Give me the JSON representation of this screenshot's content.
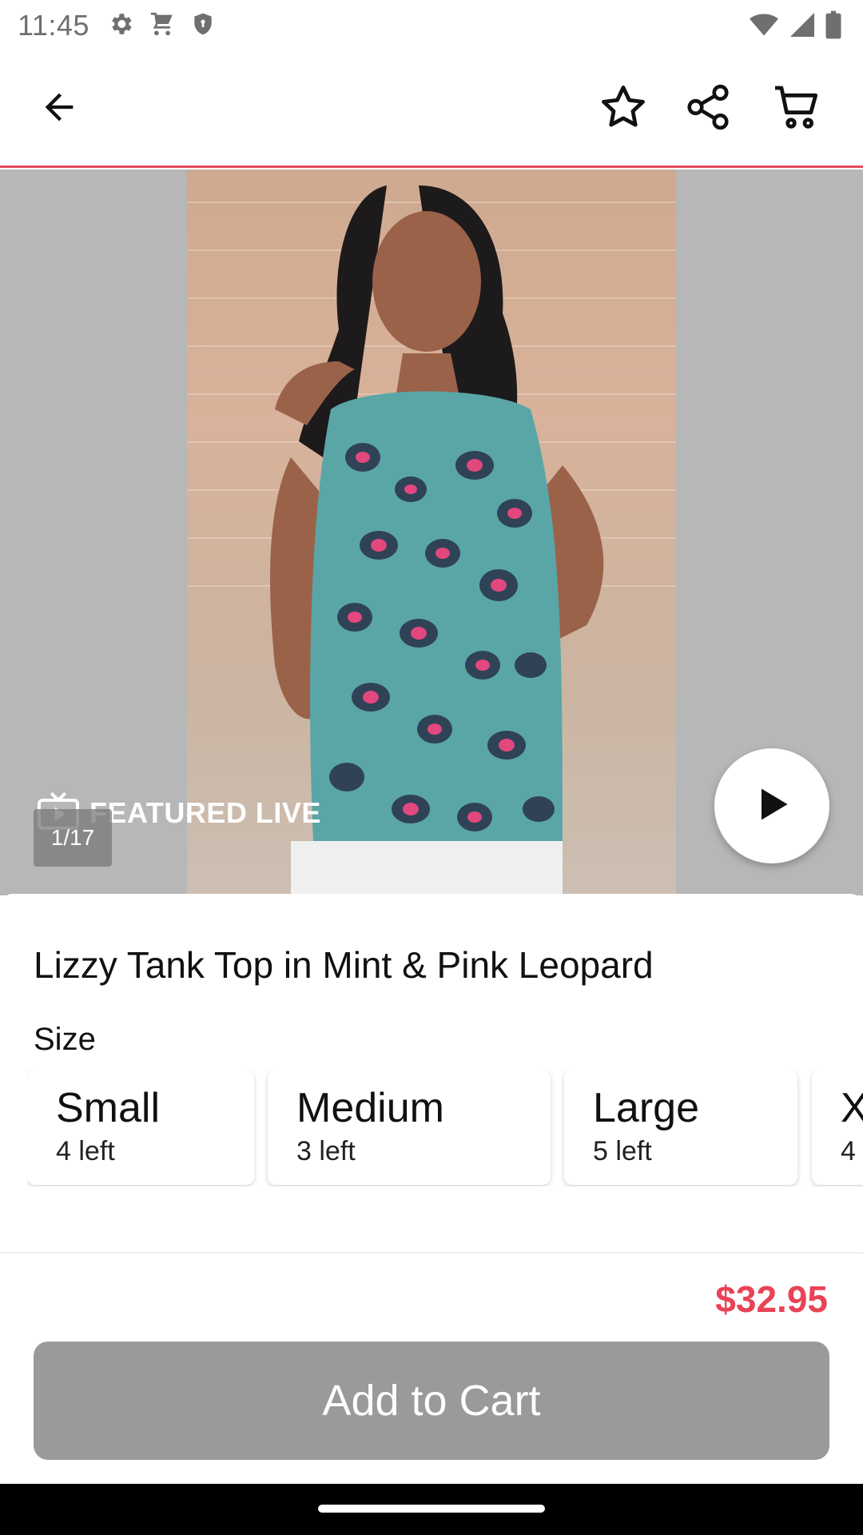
{
  "status_bar": {
    "time": "11:45",
    "left_icons": [
      "gear-icon",
      "cart-icon",
      "shield-icon"
    ],
    "right_icons": [
      "wifi-icon",
      "cellular-icon",
      "battery-icon"
    ]
  },
  "app_bar": {
    "icons": [
      "back-arrow-icon",
      "star-icon",
      "share-icon",
      "cart-icon"
    ],
    "accent_color": "#e24b5e"
  },
  "hero": {
    "featured_label": "FEATURED LIVE",
    "counter": "1/17"
  },
  "product": {
    "title": "Lizzy Tank Top in Mint & Pink Leopard",
    "size_label": "Size",
    "sizes": [
      {
        "name": "Small",
        "stock": "4 left"
      },
      {
        "name": "Medium",
        "stock": "3 left"
      },
      {
        "name": "Large",
        "stock": "5 left"
      },
      {
        "name": "X",
        "stock": "4"
      }
    ]
  },
  "purchase": {
    "price": "$32.95",
    "price_color": "#e84356",
    "add_to_cart_label": "Add to Cart"
  }
}
